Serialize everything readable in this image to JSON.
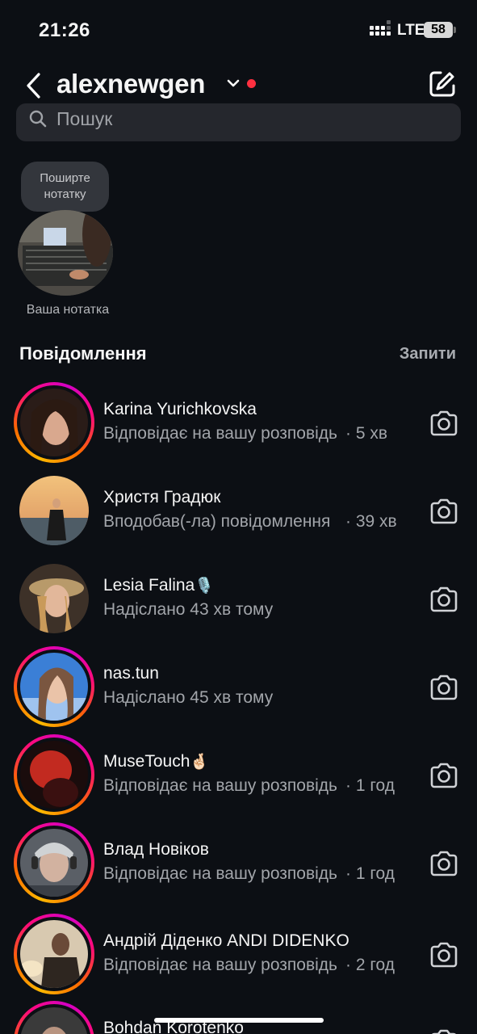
{
  "status": {
    "time": "21:26",
    "network": "LTE",
    "battery": "58"
  },
  "header": {
    "username": "alexnewgen"
  },
  "search": {
    "placeholder": "Пошук"
  },
  "note": {
    "bubble_text": "Поширте нотатку",
    "label": "Ваша нотатка"
  },
  "section": {
    "title": "Повідомлення",
    "requests": "Запити"
  },
  "chats": [
    {
      "name": "Karina Yurichkovska",
      "emoji": "",
      "preview": "Відповідає на вашу розповідь",
      "time": "· 5 хв",
      "story_ring": true
    },
    {
      "name": "Христя Градюк",
      "emoji": "",
      "preview": "Вподобав(-ла) повідомлення",
      "time": "· 39 хв",
      "story_ring": false
    },
    {
      "name": "Lesia Falina",
      "emoji": "🎙️",
      "preview": "Надіслано 43 хв тому",
      "time": "",
      "story_ring": false
    },
    {
      "name": "nas.tun",
      "emoji": "",
      "preview": "Надіслано 45 хв тому",
      "time": "",
      "story_ring": true
    },
    {
      "name": "MuseTouch",
      "emoji": "🤞🏻",
      "preview": "Відповідає на вашу розповідь",
      "time": "· 1 год",
      "story_ring": true
    },
    {
      "name": "Влад Новіков",
      "emoji": "",
      "preview": "Відповідає на вашу розповідь",
      "time": "· 1 год",
      "story_ring": true
    },
    {
      "name": "Андрій Діденко ANDI DIDENKO",
      "emoji": "",
      "preview": "Відповідає на вашу розповідь",
      "time": "· 2 год",
      "story_ring": true
    },
    {
      "name": "Bohdan Korotenko",
      "emoji": "",
      "preview": "",
      "time": "",
      "story_ring": true
    }
  ],
  "colors": {
    "background": "#0c0f14",
    "accent_red": "#ff3040",
    "search_bg": "#25272d"
  }
}
